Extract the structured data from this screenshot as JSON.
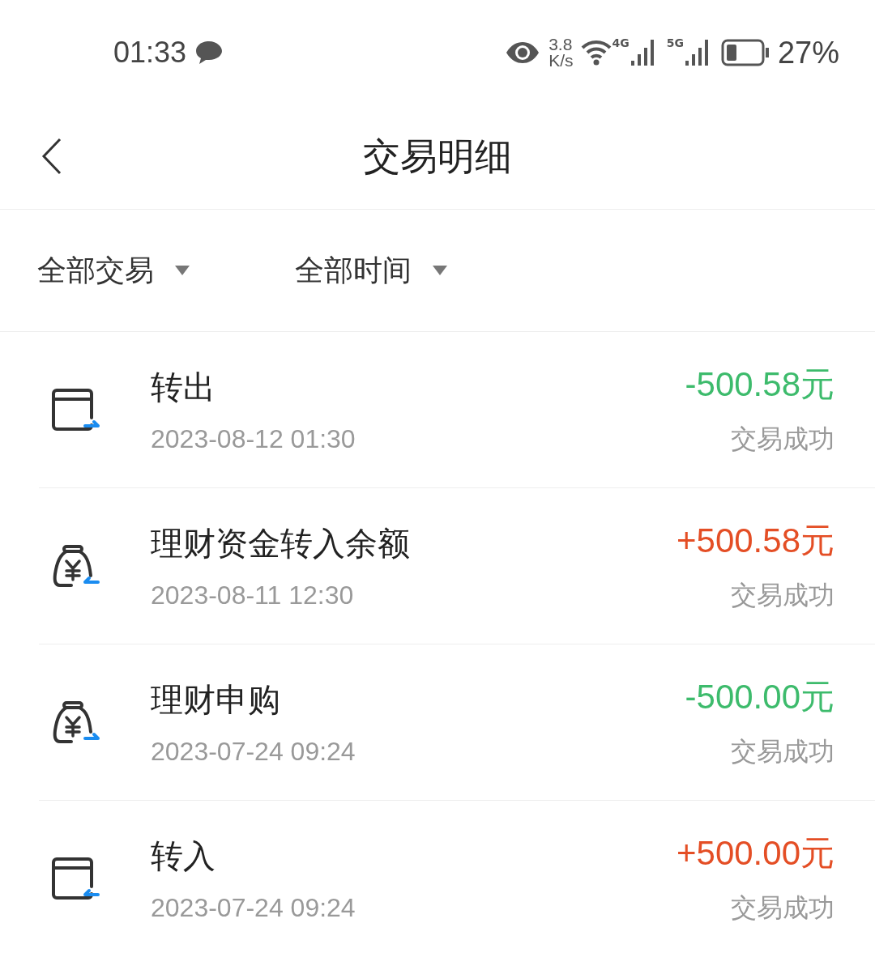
{
  "status_bar": {
    "time": "01:33",
    "speed_value": "3.8",
    "speed_unit": "K/s",
    "network_1": "4G",
    "network_2": "5G",
    "battery": "27%"
  },
  "header": {
    "title": "交易明细"
  },
  "filters": [
    {
      "label": "全部交易"
    },
    {
      "label": "全部时间"
    }
  ],
  "transactions": [
    {
      "kind": "card",
      "outgoing": true,
      "title": "转出",
      "date": "2023-08-12 01:30",
      "amount": "-500.58元",
      "status": "交易成功"
    },
    {
      "kind": "bag",
      "outgoing": false,
      "title": "理财资金转入余额",
      "date": "2023-08-11 12:30",
      "amount": "+500.58元",
      "status": "交易成功"
    },
    {
      "kind": "bag",
      "outgoing": true,
      "title": "理财申购",
      "date": "2023-07-24 09:24",
      "amount": "-500.00元",
      "status": "交易成功"
    },
    {
      "kind": "card",
      "outgoing": false,
      "title": "转入",
      "date": "2023-07-24 09:24",
      "amount": "+500.00元",
      "status": "交易成功"
    }
  ]
}
